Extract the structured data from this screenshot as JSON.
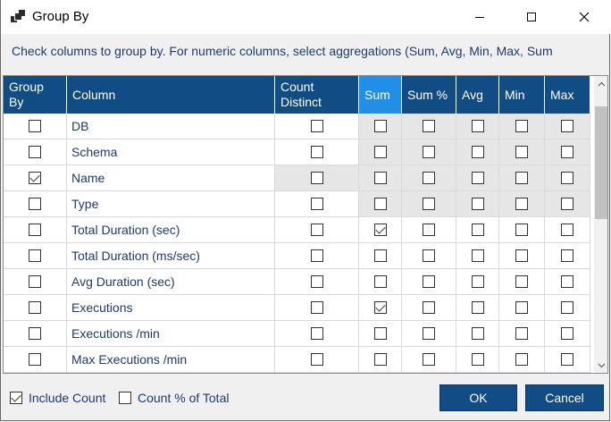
{
  "window": {
    "title": "Group By",
    "icons": {
      "app": "group-by-app-icon",
      "minimize": "minimize-icon",
      "maximize": "maximize-icon",
      "close": "close-icon"
    }
  },
  "instructions": "Check columns to group by. For numeric columns, select aggregations (Sum, Avg, Min, Max, Sum",
  "grid": {
    "headers": {
      "group_by": "Group By",
      "column": "Column",
      "count_distinct": "Count Distinct",
      "sum": "Sum",
      "sum_pct": "Sum %",
      "avg": "Avg",
      "min": "Min",
      "max": "Max"
    },
    "rows": [
      {
        "column": "DB",
        "group_by": false,
        "count_distinct": false,
        "sum": false,
        "sum_pct": false,
        "avg": false,
        "min": false,
        "max": false
      },
      {
        "column": "Schema",
        "group_by": false,
        "count_distinct": false,
        "sum": false,
        "sum_pct": false,
        "avg": false,
        "min": false,
        "max": false
      },
      {
        "column": "Name",
        "group_by": true,
        "count_distinct": false,
        "sum": false,
        "sum_pct": false,
        "avg": false,
        "min": false,
        "max": false
      },
      {
        "column": "Type",
        "group_by": false,
        "count_distinct": false,
        "sum": false,
        "sum_pct": false,
        "avg": false,
        "min": false,
        "max": false
      },
      {
        "column": "Total Duration (sec)",
        "group_by": false,
        "count_distinct": false,
        "sum": true,
        "sum_pct": false,
        "avg": false,
        "min": false,
        "max": false
      },
      {
        "column": "Total Duration (ms/sec)",
        "group_by": false,
        "count_distinct": false,
        "sum": false,
        "sum_pct": false,
        "avg": false,
        "min": false,
        "max": false
      },
      {
        "column": "Avg Duration (sec)",
        "group_by": false,
        "count_distinct": false,
        "sum": false,
        "sum_pct": false,
        "avg": false,
        "min": false,
        "max": false
      },
      {
        "column": "Executions",
        "group_by": false,
        "count_distinct": false,
        "sum": true,
        "sum_pct": false,
        "avg": false,
        "min": false,
        "max": false
      },
      {
        "column": "Executions /min",
        "group_by": false,
        "count_distinct": false,
        "sum": false,
        "sum_pct": false,
        "avg": false,
        "min": false,
        "max": false
      },
      {
        "column": "Max Executions /min",
        "group_by": false,
        "count_distinct": false,
        "sum": false,
        "sum_pct": false,
        "avg": false,
        "min": false,
        "max": false
      }
    ]
  },
  "footer": {
    "include_count": {
      "label": "Include Count",
      "checked": true
    },
    "count_pct_total": {
      "label": "Count % of Total",
      "checked": false
    },
    "ok_label": "OK",
    "cancel_label": "Cancel"
  },
  "colors": {
    "header_bg": "#124c84",
    "sum_header_bg": "#1f8fe8",
    "text": "#1e3a6e",
    "disabled_cell": "#e6e6e6"
  }
}
